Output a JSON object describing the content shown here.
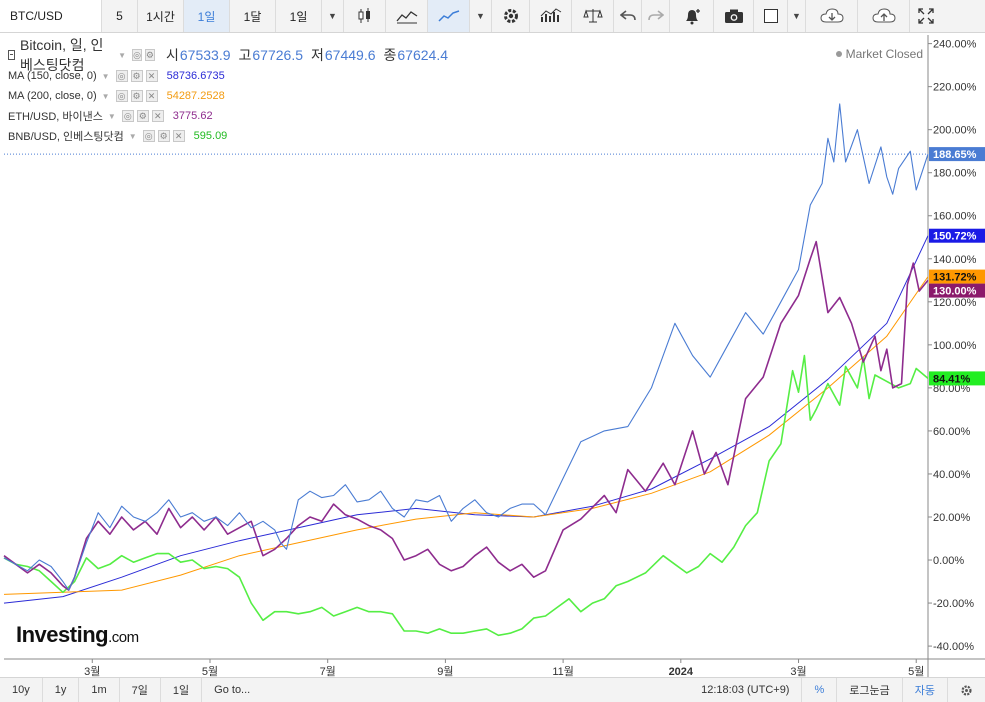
{
  "toolbar": {
    "symbol": "BTC/USD",
    "intervals": [
      "5",
      "1시간",
      "1일",
      "1달",
      "1일"
    ],
    "active_interval": "1일"
  },
  "legend": {
    "main": {
      "name": "Bitcoin, 일, 인베스팅닷컴",
      "open_label": "시",
      "open": "67533.9",
      "high_label": "고",
      "high": "67726.5",
      "low_label": "저",
      "low": "67449.6",
      "close_label": "종",
      "close": "67624.4"
    },
    "rows": [
      {
        "label": "MA (150, close, 0)",
        "value": "58736.6735",
        "color": "#2b2bd6"
      },
      {
        "label": "MA (200, close, 0)",
        "value": "54287.2528",
        "color": "#f39c12"
      },
      {
        "label": "ETH/USD, 바이낸스",
        "value": "3775.62",
        "color": "#8e2c8e"
      },
      {
        "label": "BNB/USD, 인베스팅닷컴",
        "value": "595.09",
        "color": "#22bb22"
      }
    ]
  },
  "market_status": "Market Closed",
  "logo": {
    "main": "Investing",
    "suffix": ".com"
  },
  "bottombar": {
    "ranges": [
      "10y",
      "1y",
      "1m",
      "7일",
      "1일"
    ],
    "goto": "Go to...",
    "time": "12:18:03 (UTC+9)",
    "percent": "%",
    "log": "로그눈금",
    "auto": "자동"
  },
  "chart_data": {
    "type": "line",
    "y_axis_format": "percent",
    "ylim": [
      -46,
      244
    ],
    "y_ticks": [
      "240.00%",
      "220.00%",
      "200.00%",
      "180.00%",
      "160.00%",
      "140.00%",
      "120.00%",
      "100.00%",
      "80.00%",
      "60.00%",
      "40.00%",
      "20.00%",
      "0.00%",
      "-20.00%",
      "-40.00%"
    ],
    "x_ticks": [
      "3월",
      "5월",
      "7월",
      "9월",
      "11월",
      "2024",
      "3월",
      "5월"
    ],
    "x_range_months": [
      0,
      15.7
    ],
    "x_tick_positions_months": [
      1.5,
      3.5,
      5.5,
      7.5,
      9.5,
      11.5,
      13.5,
      15.5
    ],
    "x_tick_bold": [
      false,
      false,
      false,
      false,
      false,
      true,
      false,
      false
    ],
    "last_value_labels": [
      {
        "text": "188.65%",
        "value": 188.65,
        "color": "#4a7cd3"
      },
      {
        "text": "150.72%",
        "value": 150.72,
        "color": "#1a1ae6"
      },
      {
        "text": "131.72%",
        "value": 131.72,
        "color": "#ff9800"
      },
      {
        "text": "130.00%",
        "value": 130.0,
        "color": "#8b1a6b"
      },
      {
        "text": "84.41%",
        "value": 84.41,
        "color": "#22ee22"
      }
    ],
    "series": [
      {
        "name": "Bitcoin",
        "color": "#4a7cd3",
        "width": 1.1,
        "points": [
          [
            0,
            1
          ],
          [
            0.2,
            -2
          ],
          [
            0.4,
            -5
          ],
          [
            0.6,
            0
          ],
          [
            0.8,
            -3
          ],
          [
            1.0,
            -10
          ],
          [
            1.1,
            -14
          ],
          [
            1.2,
            -8
          ],
          [
            1.4,
            8
          ],
          [
            1.6,
            22
          ],
          [
            1.8,
            15
          ],
          [
            2.0,
            25
          ],
          [
            2.2,
            20
          ],
          [
            2.4,
            18
          ],
          [
            2.6,
            22
          ],
          [
            2.8,
            28
          ],
          [
            3.0,
            20
          ],
          [
            3.2,
            22
          ],
          [
            3.4,
            18
          ],
          [
            3.6,
            20
          ],
          [
            3.8,
            16
          ],
          [
            4.0,
            22
          ],
          [
            4.2,
            15
          ],
          [
            4.4,
            18
          ],
          [
            4.6,
            14
          ],
          [
            4.7,
            8
          ],
          [
            4.8,
            5
          ],
          [
            5.0,
            28
          ],
          [
            5.2,
            32
          ],
          [
            5.4,
            29
          ],
          [
            5.6,
            30
          ],
          [
            5.8,
            35
          ],
          [
            6.0,
            27
          ],
          [
            6.2,
            28
          ],
          [
            6.4,
            32
          ],
          [
            6.6,
            24
          ],
          [
            6.8,
            20
          ],
          [
            7.0,
            28
          ],
          [
            7.2,
            27
          ],
          [
            7.4,
            30
          ],
          [
            7.6,
            18
          ],
          [
            7.8,
            24
          ],
          [
            8.0,
            28
          ],
          [
            8.2,
            22
          ],
          [
            8.4,
            20
          ],
          [
            8.6,
            24
          ],
          [
            8.8,
            26
          ],
          [
            9.0,
            26
          ],
          [
            9.2,
            21
          ],
          [
            9.5,
            38
          ],
          [
            9.8,
            55
          ],
          [
            10.2,
            60
          ],
          [
            10.6,
            62
          ],
          [
            11.0,
            80
          ],
          [
            11.4,
            110
          ],
          [
            11.7,
            95
          ],
          [
            12.0,
            85
          ],
          [
            12.3,
            100
          ],
          [
            12.6,
            115
          ],
          [
            12.9,
            105
          ],
          [
            13.2,
            120
          ],
          [
            13.5,
            135
          ],
          [
            13.7,
            165
          ],
          [
            13.9,
            175
          ],
          [
            14.0,
            196
          ],
          [
            14.1,
            185
          ],
          [
            14.2,
            212
          ],
          [
            14.3,
            185
          ],
          [
            14.5,
            200
          ],
          [
            14.7,
            175
          ],
          [
            14.9,
            192
          ],
          [
            15.0,
            178
          ],
          [
            15.1,
            170
          ],
          [
            15.2,
            182
          ],
          [
            15.4,
            190
          ],
          [
            15.5,
            172
          ],
          [
            15.7,
            188.65
          ]
        ]
      },
      {
        "name": "MA (150, close, 0)",
        "color": "#2b2bd6",
        "width": 1.0,
        "points": [
          [
            0,
            -20
          ],
          [
            1,
            -17
          ],
          [
            2,
            -8
          ],
          [
            3,
            2
          ],
          [
            4,
            9
          ],
          [
            5,
            15
          ],
          [
            6,
            21
          ],
          [
            7,
            24
          ],
          [
            8,
            21
          ],
          [
            9,
            20
          ],
          [
            10,
            25
          ],
          [
            11,
            33
          ],
          [
            12,
            47
          ],
          [
            13,
            62
          ],
          [
            14,
            84
          ],
          [
            15,
            110
          ],
          [
            15.7,
            150.72
          ]
        ]
      },
      {
        "name": "MA (200, close, 0)",
        "color": "#ff9800",
        "width": 1.0,
        "points": [
          [
            0,
            -16
          ],
          [
            1,
            -15
          ],
          [
            2,
            -14
          ],
          [
            3,
            -7
          ],
          [
            4,
            2
          ],
          [
            5,
            8
          ],
          [
            6,
            14
          ],
          [
            7,
            19
          ],
          [
            8,
            22
          ],
          [
            9,
            20
          ],
          [
            10,
            24
          ],
          [
            11,
            31
          ],
          [
            12,
            41
          ],
          [
            13,
            58
          ],
          [
            14,
            80
          ],
          [
            15,
            104
          ],
          [
            15.7,
            131.72
          ]
        ]
      },
      {
        "name": "ETH/USD, 바이낸스",
        "color": "#8e2c8e",
        "width": 1.6,
        "points": [
          [
            0,
            2
          ],
          [
            0.2,
            -2
          ],
          [
            0.4,
            -6
          ],
          [
            0.6,
            -2
          ],
          [
            0.8,
            -6
          ],
          [
            1.0,
            -12
          ],
          [
            1.1,
            -14
          ],
          [
            1.2,
            -8
          ],
          [
            1.4,
            10
          ],
          [
            1.6,
            18
          ],
          [
            1.8,
            12
          ],
          [
            2.0,
            20
          ],
          [
            2.2,
            14
          ],
          [
            2.4,
            18
          ],
          [
            2.6,
            12
          ],
          [
            2.8,
            24
          ],
          [
            3.0,
            15
          ],
          [
            3.2,
            20
          ],
          [
            3.4,
            14
          ],
          [
            3.6,
            20
          ],
          [
            3.8,
            12
          ],
          [
            4.0,
            15
          ],
          [
            4.2,
            18
          ],
          [
            4.4,
            2
          ],
          [
            4.6,
            5
          ],
          [
            4.8,
            10
          ],
          [
            5.0,
            16
          ],
          [
            5.2,
            20
          ],
          [
            5.4,
            18
          ],
          [
            5.6,
            26
          ],
          [
            5.8,
            21
          ],
          [
            6.0,
            19
          ],
          [
            6.2,
            16
          ],
          [
            6.4,
            14
          ],
          [
            6.6,
            10
          ],
          [
            6.8,
            0
          ],
          [
            7.0,
            2
          ],
          [
            7.2,
            5
          ],
          [
            7.4,
            -2
          ],
          [
            7.6,
            -5
          ],
          [
            7.8,
            -3
          ],
          [
            8.0,
            2
          ],
          [
            8.2,
            6
          ],
          [
            8.4,
            -1
          ],
          [
            8.6,
            -5
          ],
          [
            8.8,
            -2
          ],
          [
            9.0,
            -8
          ],
          [
            9.2,
            -5
          ],
          [
            9.5,
            14
          ],
          [
            9.8,
            19
          ],
          [
            10.2,
            30
          ],
          [
            10.4,
            22
          ],
          [
            10.6,
            42
          ],
          [
            10.9,
            32
          ],
          [
            11.2,
            45
          ],
          [
            11.4,
            35
          ],
          [
            11.7,
            60
          ],
          [
            11.9,
            40
          ],
          [
            12.1,
            50
          ],
          [
            12.3,
            35
          ],
          [
            12.6,
            75
          ],
          [
            12.9,
            85
          ],
          [
            13.2,
            110
          ],
          [
            13.5,
            123
          ],
          [
            13.7,
            140
          ],
          [
            13.8,
            148
          ],
          [
            14.0,
            115
          ],
          [
            14.2,
            122
          ],
          [
            14.4,
            110
          ],
          [
            14.6,
            92
          ],
          [
            14.8,
            104
          ],
          [
            14.9,
            88
          ],
          [
            15.0,
            98
          ],
          [
            15.1,
            80
          ],
          [
            15.25,
            82
          ],
          [
            15.35,
            128
          ],
          [
            15.45,
            138
          ],
          [
            15.55,
            125
          ],
          [
            15.7,
            130
          ]
        ]
      },
      {
        "name": "BNB/USD, 인베스팅닷컴",
        "color": "#55ee44",
        "width": 1.6,
        "points": [
          [
            0,
            1
          ],
          [
            0.2,
            -2
          ],
          [
            0.4,
            -3
          ],
          [
            0.6,
            -5
          ],
          [
            0.8,
            -10
          ],
          [
            1.0,
            -15
          ],
          [
            1.2,
            -10
          ],
          [
            1.4,
            1
          ],
          [
            1.6,
            -4
          ],
          [
            1.8,
            -2
          ],
          [
            2.0,
            2
          ],
          [
            2.2,
            -1
          ],
          [
            2.4,
            1
          ],
          [
            2.6,
            3
          ],
          [
            2.8,
            3
          ],
          [
            3.0,
            -1
          ],
          [
            3.2,
            0
          ],
          [
            3.4,
            -4
          ],
          [
            3.6,
            -3
          ],
          [
            3.8,
            -4
          ],
          [
            4.0,
            -8
          ],
          [
            4.2,
            -20
          ],
          [
            4.4,
            -28
          ],
          [
            4.6,
            -24
          ],
          [
            4.8,
            -24
          ],
          [
            5.0,
            -25
          ],
          [
            5.2,
            -24
          ],
          [
            5.4,
            -22
          ],
          [
            5.6,
            -26
          ],
          [
            5.8,
            -24
          ],
          [
            6.0,
            -22
          ],
          [
            6.2,
            -24
          ],
          [
            6.4,
            -24
          ],
          [
            6.6,
            -25
          ],
          [
            6.8,
            -33
          ],
          [
            7.0,
            -33
          ],
          [
            7.2,
            -34
          ],
          [
            7.4,
            -32
          ],
          [
            7.6,
            -34
          ],
          [
            7.8,
            -34
          ],
          [
            8.0,
            -33
          ],
          [
            8.2,
            -32
          ],
          [
            8.4,
            -35
          ],
          [
            8.6,
            -34
          ],
          [
            8.8,
            -32
          ],
          [
            9.0,
            -27
          ],
          [
            9.2,
            -26
          ],
          [
            9.4,
            -22
          ],
          [
            9.6,
            -18
          ],
          [
            9.8,
            -24
          ],
          [
            10.0,
            -20
          ],
          [
            10.2,
            -18
          ],
          [
            10.4,
            -12
          ],
          [
            10.6,
            -10
          ],
          [
            10.9,
            -6
          ],
          [
            11.2,
            2
          ],
          [
            11.4,
            -2
          ],
          [
            11.6,
            -6
          ],
          [
            11.8,
            -3
          ],
          [
            12.0,
            3
          ],
          [
            12.2,
            -1
          ],
          [
            12.4,
            6
          ],
          [
            12.6,
            16
          ],
          [
            12.8,
            22
          ],
          [
            13.0,
            46
          ],
          [
            13.2,
            54
          ],
          [
            13.4,
            88
          ],
          [
            13.5,
            78
          ],
          [
            13.6,
            95
          ],
          [
            13.7,
            65
          ],
          [
            13.8,
            70
          ],
          [
            14.0,
            82
          ],
          [
            14.2,
            72
          ],
          [
            14.3,
            90
          ],
          [
            14.5,
            80
          ],
          [
            14.6,
            94
          ],
          [
            14.7,
            75
          ],
          [
            14.8,
            86
          ],
          [
            15.0,
            83
          ],
          [
            15.2,
            80
          ],
          [
            15.4,
            82
          ],
          [
            15.5,
            89
          ],
          [
            15.7,
            84.41
          ]
        ]
      }
    ]
  }
}
